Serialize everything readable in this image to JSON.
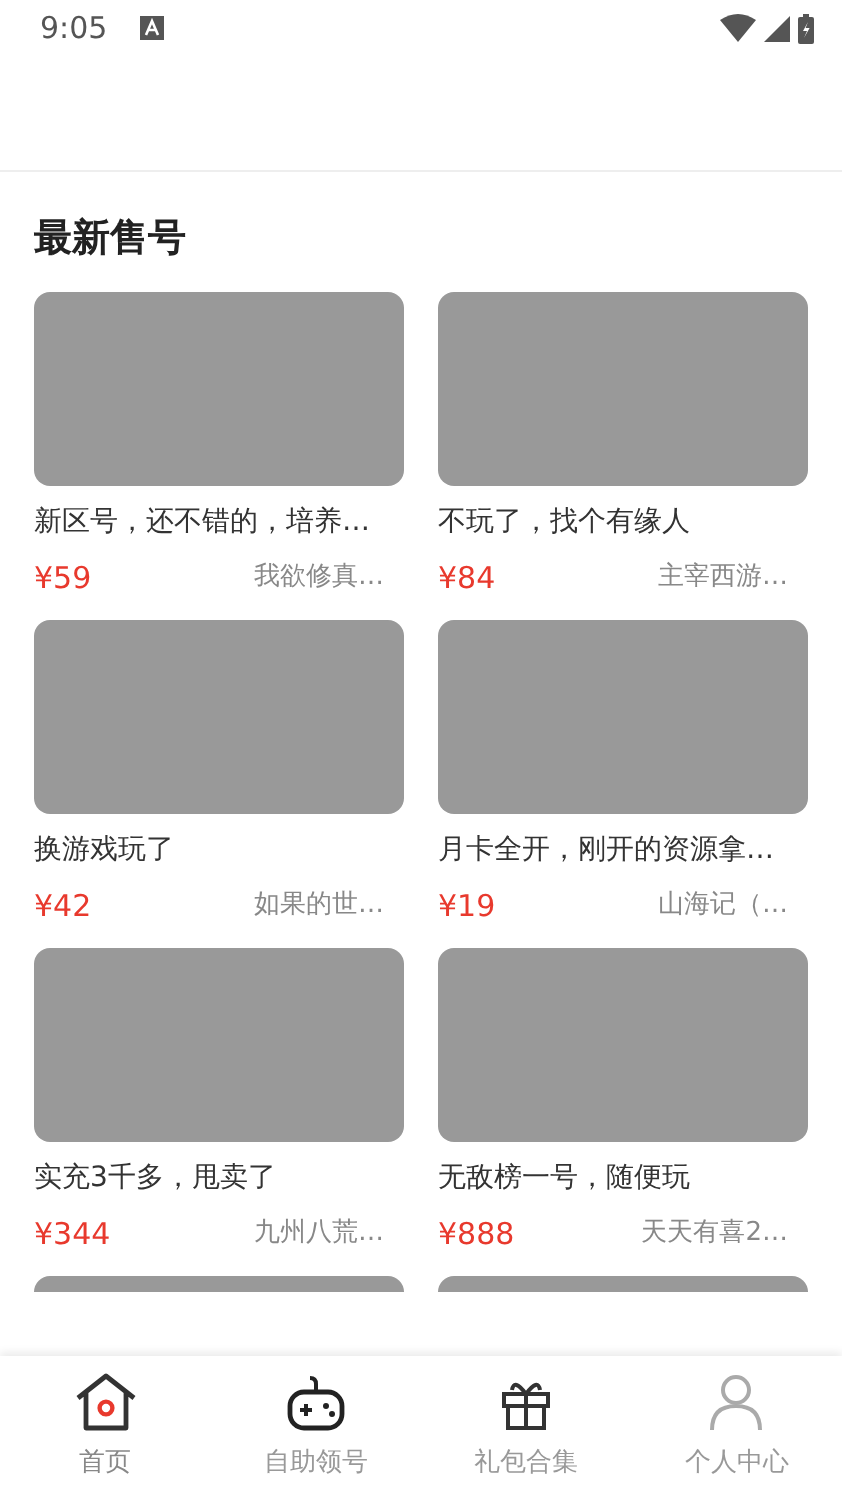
{
  "status_bar": {
    "time": "9:05"
  },
  "section": {
    "title": "最新售号"
  },
  "listings": [
    {
      "kind": "full",
      "title": "新区号，还不错的，培养…",
      "price": "¥59",
      "game": "我欲修真…"
    },
    {
      "kind": "full",
      "title": "不玩了，找个有缘人",
      "price": "¥84",
      "game": "主宰西游…"
    },
    {
      "kind": "full",
      "title": "换游戏玩了",
      "price": "¥42",
      "game": "如果的世…"
    },
    {
      "kind": "full",
      "title": "月卡全开，刚开的资源拿…",
      "price": "¥19",
      "game": "山海记（…"
    },
    {
      "kind": "full",
      "title": "实充3千多，甩卖了",
      "price": "¥344",
      "game": "九州八荒…"
    },
    {
      "kind": "full",
      "title": "无敌榜一号，随便玩",
      "price": "¥888",
      "game": "天天有喜2…"
    },
    {
      "kind": "image_only"
    },
    {
      "kind": "image_only"
    }
  ],
  "tab_bar": [
    {
      "label": "首页",
      "kind": "home",
      "selected": true
    },
    {
      "label": "自助领号",
      "kind": "gamepad",
      "selected": false
    },
    {
      "label": "礼包合集",
      "kind": "gift",
      "selected": false
    },
    {
      "label": "个人中心",
      "kind": "person",
      "selected": false
    }
  ]
}
